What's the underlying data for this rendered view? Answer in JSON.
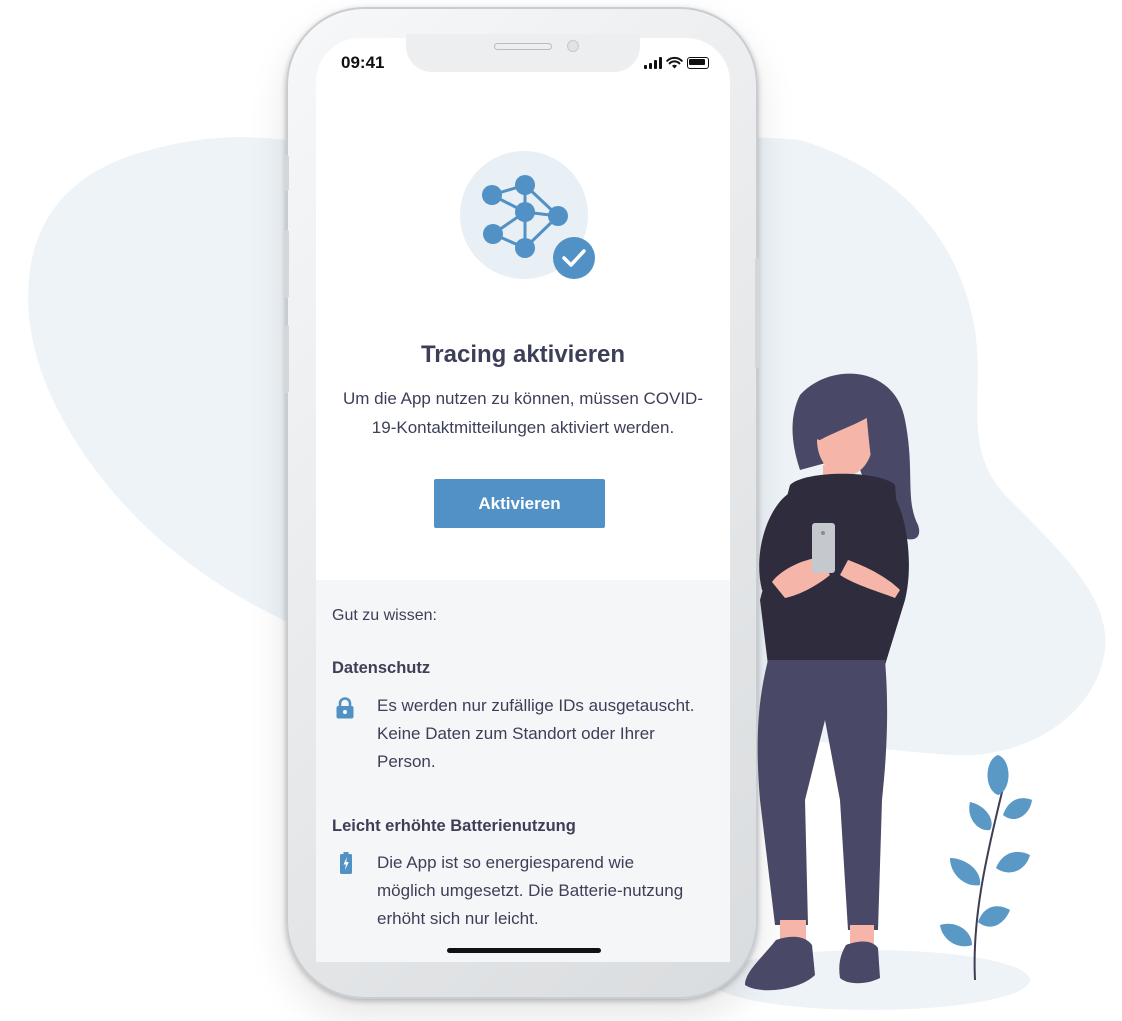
{
  "status_bar": {
    "time": "09:41",
    "icons": [
      "cellular-signal-icon",
      "wifi-icon",
      "battery-icon"
    ]
  },
  "hero": {
    "icon": "network-check-icon"
  },
  "onboarding": {
    "title": "Tracing aktivieren",
    "description": "Um die App nutzen zu können, müssen COVID-19-Kontaktmitteilungen aktiviert werden.",
    "button_label": "Aktivieren"
  },
  "info": {
    "intro": "Gut zu wissen:",
    "sections": [
      {
        "heading": "Datenschutz",
        "icon": "lock-icon",
        "text": "Es werden nur zufällige IDs ausgetauscht. Keine Daten zum Standort oder Ihrer Person."
      },
      {
        "heading": "Leicht erhöhte Batterienutzung",
        "icon": "battery-charging-icon",
        "text": "Die App ist so energiesparend wie möglich umgesetzt. Die Batterie-nutzung erhöht sich nur leicht."
      }
    ]
  },
  "colors": {
    "accent": "#5291c5",
    "text": "#3d3f58",
    "panel": "#f5f6f7",
    "backdrop_blob": "#edf3f7"
  }
}
